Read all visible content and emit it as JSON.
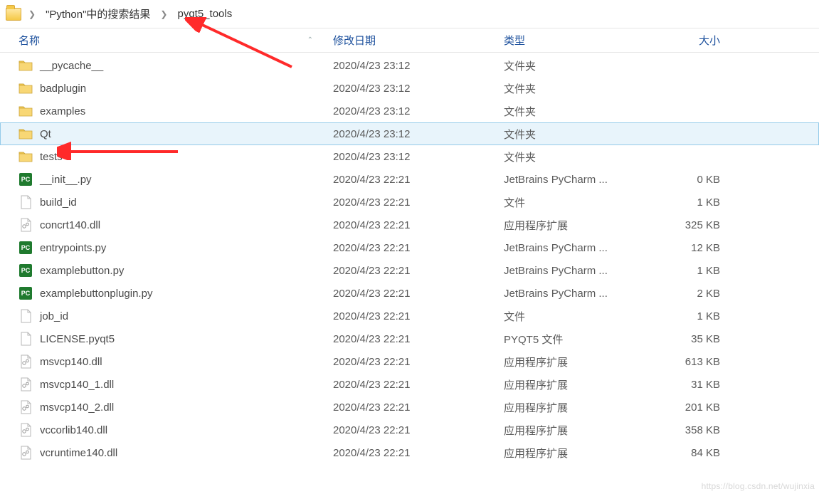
{
  "breadcrumb": {
    "part1": "\"Python\"中的搜索结果",
    "part2": "pyqt5_tools"
  },
  "columns": {
    "name": "名称",
    "date": "修改日期",
    "type": "类型",
    "size": "大小"
  },
  "files": [
    {
      "icon": "folder",
      "name": "__pycache__",
      "date": "2020/4/23 23:12",
      "type": "文件夹",
      "size": "",
      "selected": false
    },
    {
      "icon": "folder",
      "name": "badplugin",
      "date": "2020/4/23 23:12",
      "type": "文件夹",
      "size": "",
      "selected": false
    },
    {
      "icon": "folder",
      "name": "examples",
      "date": "2020/4/23 23:12",
      "type": "文件夹",
      "size": "",
      "selected": false
    },
    {
      "icon": "folder",
      "name": "Qt",
      "date": "2020/4/23 23:12",
      "type": "文件夹",
      "size": "",
      "selected": true
    },
    {
      "icon": "folder",
      "name": "tests",
      "date": "2020/4/23 23:12",
      "type": "文件夹",
      "size": "",
      "selected": false
    },
    {
      "icon": "py",
      "name": "__init__.py",
      "date": "2020/4/23 22:21",
      "type": "JetBrains PyCharm ...",
      "size": "0 KB",
      "selected": false
    },
    {
      "icon": "file",
      "name": "build_id",
      "date": "2020/4/23 22:21",
      "type": "文件",
      "size": "1 KB",
      "selected": false
    },
    {
      "icon": "dll",
      "name": "concrt140.dll",
      "date": "2020/4/23 22:21",
      "type": "应用程序扩展",
      "size": "325 KB",
      "selected": false
    },
    {
      "icon": "py",
      "name": "entrypoints.py",
      "date": "2020/4/23 22:21",
      "type": "JetBrains PyCharm ...",
      "size": "12 KB",
      "selected": false
    },
    {
      "icon": "py",
      "name": "examplebutton.py",
      "date": "2020/4/23 22:21",
      "type": "JetBrains PyCharm ...",
      "size": "1 KB",
      "selected": false
    },
    {
      "icon": "py",
      "name": "examplebuttonplugin.py",
      "date": "2020/4/23 22:21",
      "type": "JetBrains PyCharm ...",
      "size": "2 KB",
      "selected": false
    },
    {
      "icon": "file",
      "name": "job_id",
      "date": "2020/4/23 22:21",
      "type": "文件",
      "size": "1 KB",
      "selected": false
    },
    {
      "icon": "file",
      "name": "LICENSE.pyqt5",
      "date": "2020/4/23 22:21",
      "type": "PYQT5 文件",
      "size": "35 KB",
      "selected": false
    },
    {
      "icon": "dll",
      "name": "msvcp140.dll",
      "date": "2020/4/23 22:21",
      "type": "应用程序扩展",
      "size": "613 KB",
      "selected": false
    },
    {
      "icon": "dll",
      "name": "msvcp140_1.dll",
      "date": "2020/4/23 22:21",
      "type": "应用程序扩展",
      "size": "31 KB",
      "selected": false
    },
    {
      "icon": "dll",
      "name": "msvcp140_2.dll",
      "date": "2020/4/23 22:21",
      "type": "应用程序扩展",
      "size": "201 KB",
      "selected": false
    },
    {
      "icon": "dll",
      "name": "vccorlib140.dll",
      "date": "2020/4/23 22:21",
      "type": "应用程序扩展",
      "size": "358 KB",
      "selected": false
    },
    {
      "icon": "dll",
      "name": "vcruntime140.dll",
      "date": "2020/4/23 22:21",
      "type": "应用程序扩展",
      "size": "84 KB",
      "selected": false
    }
  ],
  "watermark": "https://blog.csdn.net/wujinxia"
}
